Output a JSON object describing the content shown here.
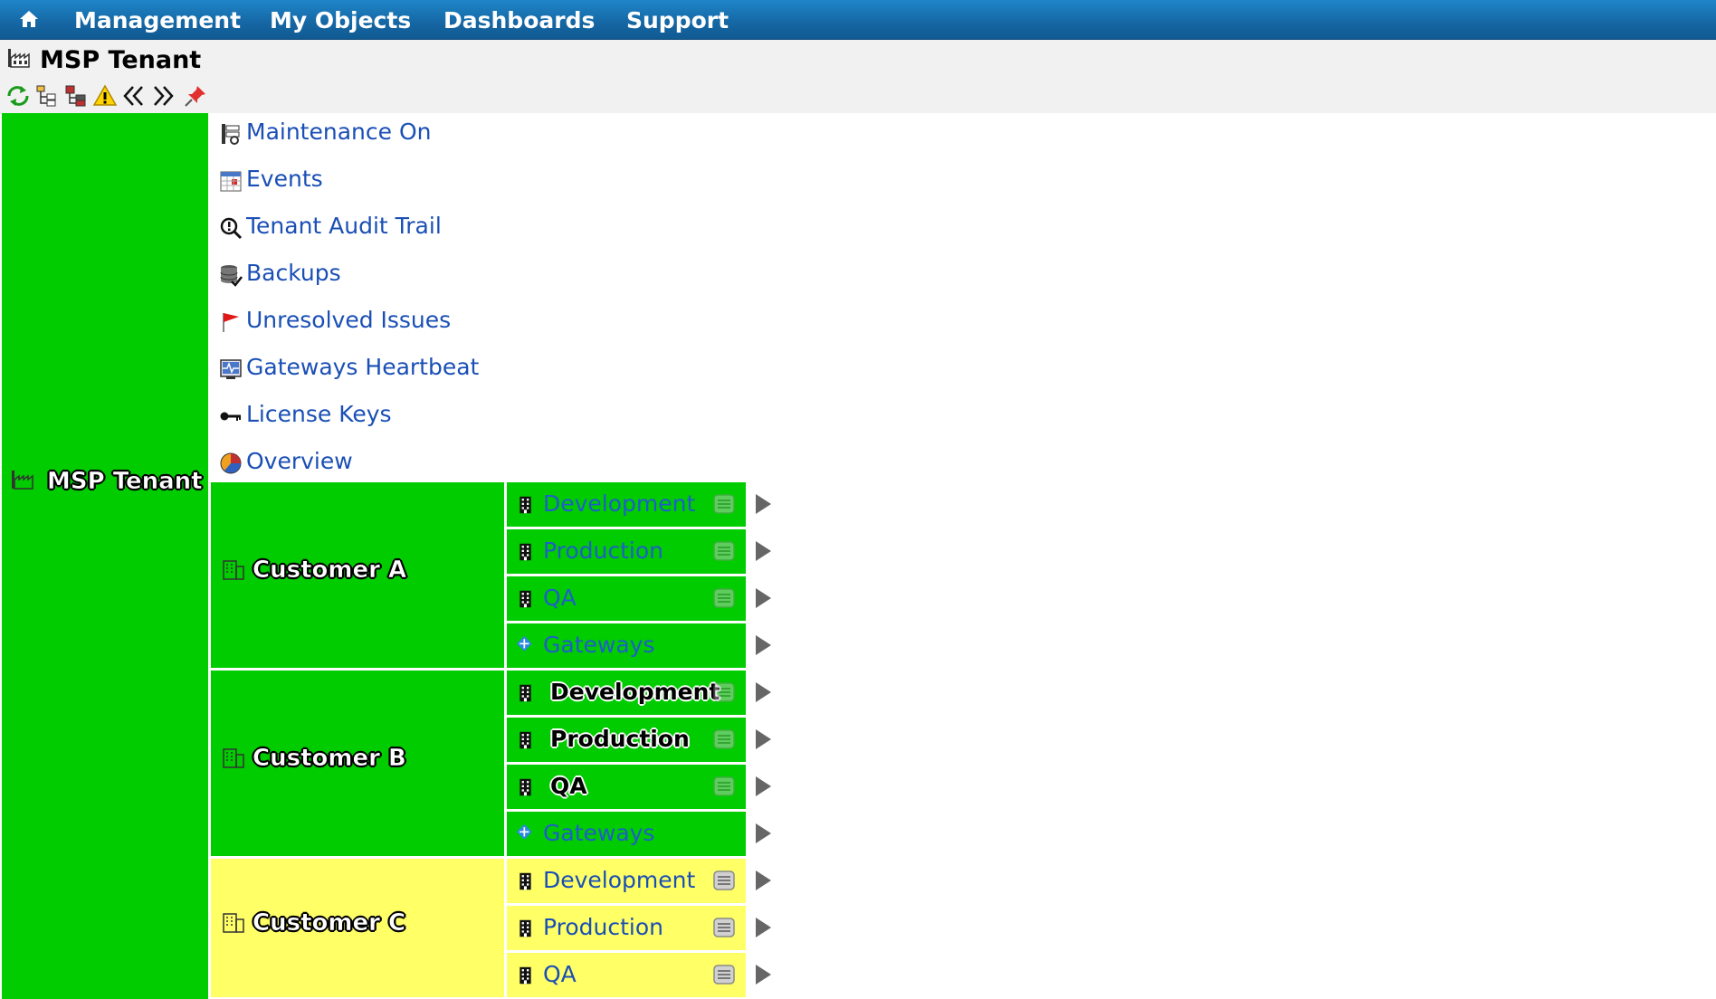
{
  "nav": {
    "items": [
      "Management",
      "My Objects",
      "Dashboards",
      "Support"
    ]
  },
  "header": {
    "title": "MSP Tenant"
  },
  "toolbar": {
    "icons": [
      "refresh-icon",
      "tree-icon",
      "hierarchy-icon",
      "warning-icon",
      "collapse-icon",
      "expand-icon",
      "pin-icon"
    ]
  },
  "root": {
    "label": "MSP Tenant"
  },
  "links": [
    {
      "label": "Maintenance On",
      "icon": "maintenance-icon"
    },
    {
      "label": "Events",
      "icon": "calendar-icon"
    },
    {
      "label": "Tenant Audit Trail",
      "icon": "audit-icon"
    },
    {
      "label": "Backups",
      "icon": "database-icon"
    },
    {
      "label": "Unresolved Issues",
      "icon": "flag-icon"
    },
    {
      "label": "Gateways Heartbeat",
      "icon": "heartbeat-icon"
    },
    {
      "label": "License Keys",
      "icon": "key-icon"
    },
    {
      "label": "Overview",
      "icon": "pie-chart-icon"
    }
  ],
  "customers": [
    {
      "label": "Customer A",
      "status_color": "#00cc00",
      "envs": [
        {
          "label": "Development",
          "icon": "building-icon",
          "menu": true
        },
        {
          "label": "Production",
          "icon": "building-icon",
          "menu": true
        },
        {
          "label": "QA",
          "icon": "building-icon",
          "menu": true
        },
        {
          "label": "Gateways",
          "icon": "gateway-icon",
          "menu": false
        }
      ]
    },
    {
      "label": "Customer B",
      "status_color": "#00cc00",
      "envs": [
        {
          "label": "Development",
          "icon": "building-icon",
          "menu": true,
          "strong": true
        },
        {
          "label": "Production",
          "icon": "building-icon",
          "menu": true,
          "strong": true
        },
        {
          "label": "QA",
          "icon": "building-icon",
          "menu": true,
          "strong": true
        },
        {
          "label": "Gateways",
          "icon": "gateway-icon",
          "menu": false
        }
      ]
    },
    {
      "label": "Customer C",
      "status_color": "#ffff66",
      "envs": [
        {
          "label": "Development",
          "icon": "building-icon",
          "menu": true
        },
        {
          "label": "Production",
          "icon": "building-icon",
          "menu": true
        },
        {
          "label": "QA",
          "icon": "building-icon",
          "menu": true
        }
      ]
    }
  ],
  "colors": {
    "ok": "#00cc00",
    "warning": "#ffff66",
    "link": "#1a4fb5",
    "nav": "#1566a3"
  }
}
